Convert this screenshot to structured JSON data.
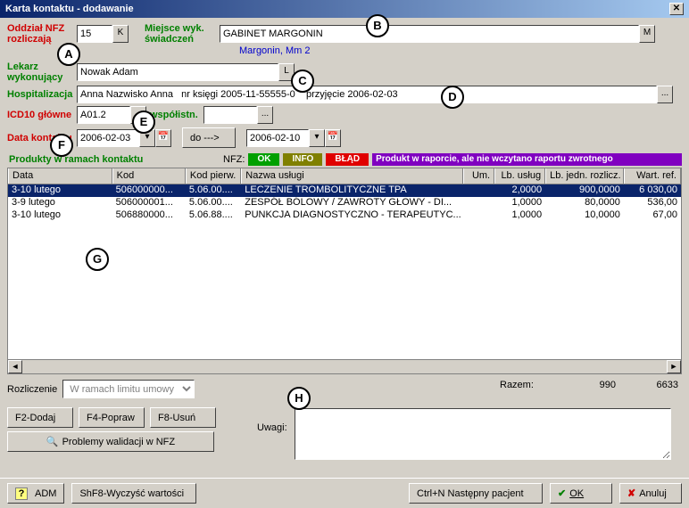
{
  "title": "Karta kontaktu - dodawanie",
  "labels": {
    "oddzial": "Oddział NFZ rozliczają",
    "miejsce": "Miejsce wyk. świadczeń",
    "lekarz": "Lekarz wykonujący",
    "hospitalizacja": "Hospitalizacja",
    "icd10g": "ICD10 główne",
    "icd10w": "współistn.",
    "data": "Data kontaktu",
    "do": "do --->",
    "produkty": "Produkty w ramach kontaktu",
    "nfz": "NFZ:",
    "rozliczenie": "Rozliczenie",
    "uwagi": "Uwagi:",
    "razem": "Razem:"
  },
  "fields": {
    "oddzial": "15",
    "miejsce": "GABINET MARGONIN",
    "miejsce_sub": "Margonin, Mm 2",
    "lekarz": "Nowak Adam",
    "hospitalizacja": "Anna Nazwisko Anna   nr księgi 2005-11-55555-0    przyjęcie 2006-02-03",
    "icd10g": "A01.2",
    "icd10w": "",
    "data_od": "2006-02-03",
    "data_do": "2006-02-10",
    "rozliczenie": "W ramach limitu umowy"
  },
  "tags": {
    "ok": "OK",
    "info": "INFO",
    "err": "BŁĄD",
    "report": "Produkt w raporcie, ale nie wczytano raportu zwrotnego"
  },
  "grid": {
    "headers": [
      "Data",
      "Kod",
      "Kod pierw.",
      "Nazwa usługi",
      "Um.",
      "Lb. usług",
      "Lb. jedn. rozlicz.",
      "Wart. ref."
    ],
    "rows": [
      {
        "sel": true,
        "c": [
          "3-10 lutego",
          "506000000...",
          "5.06.00....",
          "LECZENIE TROMBOLITYCZNE TPA",
          "",
          "2,0000",
          "900,0000",
          "6 030,00"
        ]
      },
      {
        "sel": false,
        "c": [
          "3-9 lutego",
          "506000001...",
          "5.06.00....",
          "ZESPÓŁ BÓLOWY / ZAWROTY GŁOWY - DI...",
          "",
          "1,0000",
          "80,0000",
          "536,00"
        ]
      },
      {
        "sel": false,
        "c": [
          "3-10 lutego",
          "506880000...",
          "5.06.88....",
          "PUNKCJA DIAGNOSTYCZNO - TERAPEUTYC...",
          "",
          "1,0000",
          "10,0000",
          "67,00"
        ]
      }
    ]
  },
  "totals": {
    "v1": "990",
    "v2": "6633"
  },
  "buttons": {
    "f2": "F2-Dodaj",
    "f4": "F4-Popraw",
    "f8": "F8-Usuń",
    "problemy": "Problemy walidacji w NFZ",
    "adm": "ADM",
    "shf8": "ShF8-Wyczyść wartości",
    "ctrln": "Ctrl+N Następny pacjent",
    "ok": "OK",
    "anuluj": "Anuluj"
  },
  "callouts": {
    "A": "A",
    "B": "B",
    "C": "C",
    "D": "D",
    "E": "E",
    "F": "F",
    "G": "G",
    "H": "H"
  }
}
